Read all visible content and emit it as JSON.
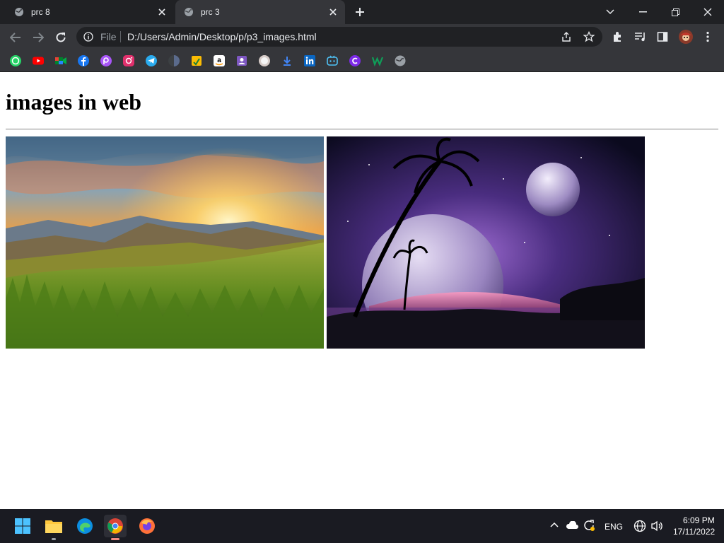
{
  "browser": {
    "tabs": [
      {
        "label": "prc 8",
        "active": false
      },
      {
        "label": "prc 3",
        "active": true
      }
    ],
    "address": {
      "scheme_label": "File",
      "url": "D:/Users/Admin/Desktop/p/p3_images.html"
    }
  },
  "bookmarks": [
    "whatsapp-icon",
    "youtube-icon",
    "meet-icon",
    "facebook-icon",
    "picsart-icon",
    "instagram-icon",
    "telegram-icon",
    "dark-circle-icon",
    "notes-icon",
    "amazon-icon",
    "contacts-icon",
    "avatar-circle-icon",
    "download-icon",
    "linkedin-icon",
    "bot-icon",
    "canva-icon",
    "w-icon",
    "globe-icon"
  ],
  "page": {
    "heading": "images in web",
    "images": [
      {
        "alt": "sunrise over mountains and grass"
      },
      {
        "alt": "palm trees under planets at night"
      }
    ]
  },
  "taskbar": {
    "apps": [
      "windows-start-icon",
      "file-explorer-icon",
      "edge-icon",
      "chrome-icon",
      "firefox-icon"
    ],
    "language": "ENG",
    "time": "6:09 PM",
    "date": "17/11/2022"
  }
}
